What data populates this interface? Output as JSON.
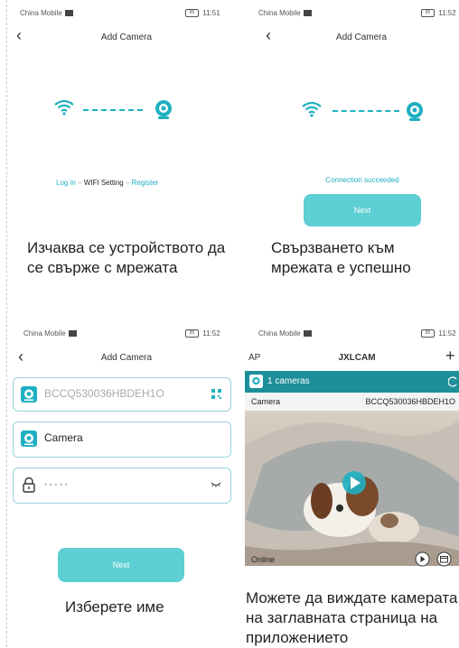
{
  "colors": {
    "accent": "#1fb0c2",
    "button": "#5ecfd5",
    "dark_header": "#1d8f99"
  },
  "status_bar": {
    "carrier": "China Mobile",
    "battery": "85",
    "times": [
      "11:51",
      "11:52",
      "11:52",
      "11:52"
    ]
  },
  "screen1": {
    "title": "Add Camera",
    "links": {
      "login": "Log in",
      "sep": "–",
      "wifi": "WIFI Setting",
      "register": "Register"
    },
    "caption": "Изчаква се устройството да се свърже с мрежата"
  },
  "screen2": {
    "title": "Add Camera",
    "status": "Connection succeeded",
    "next": "Next",
    "caption": "Свързването към мрежата е успешно"
  },
  "screen3": {
    "title": "Add Camera",
    "device_id": "BCCQ530036HBDEH1O",
    "name_value": "Camera",
    "password_mask": "• • • • •",
    "next": "Next",
    "caption": "Изберете име"
  },
  "screen4": {
    "left_label": "AP",
    "title": "JXLCAM",
    "plus": "+",
    "cameras_count": "1 cameras",
    "camera_name": "Camera",
    "camera_id": "BCCQ530036HBDEH1O",
    "status": "Online",
    "caption": "Можете да виждате камерата на заглавната страница на приложението"
  }
}
